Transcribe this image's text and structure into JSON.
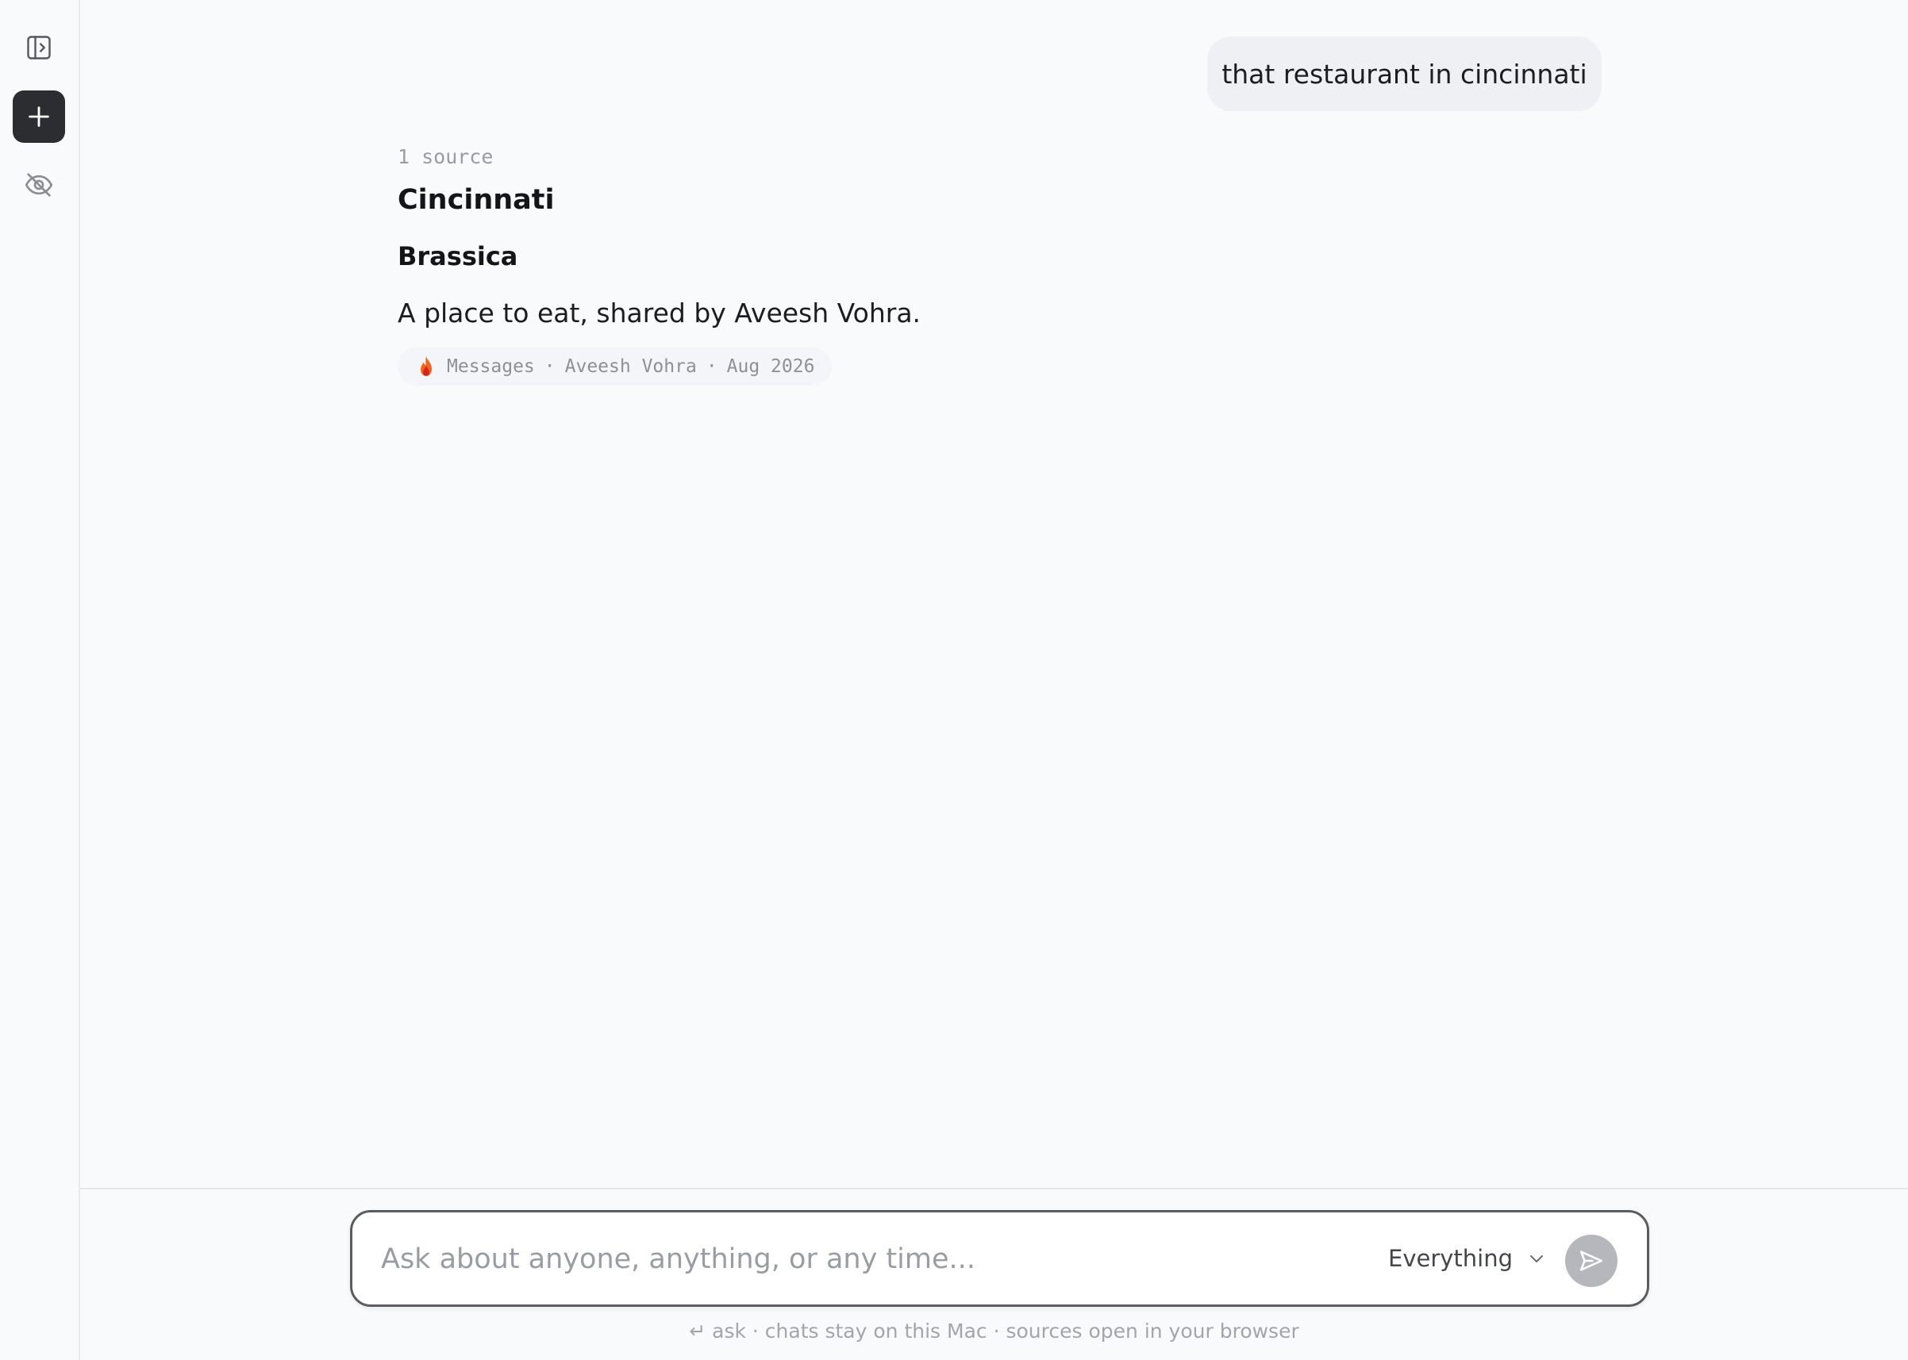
{
  "sidebar": {
    "toggle_icon": "sidebar-toggle-icon",
    "new_chat_icon": "plus-icon",
    "private_icon": "eye-off-icon"
  },
  "conversation": {
    "user_message": "that restaurant in cincinnati",
    "source_count": "1 source",
    "heading": "Cincinnati",
    "subheading": "Brassica",
    "body": "A place to eat, shared by Aveesh Vohra.",
    "citation": {
      "icon": "flame-icon",
      "app": "Messages",
      "person": "Aveesh Vohra",
      "date": "Aug 2026",
      "separator": "·"
    }
  },
  "composer": {
    "placeholder": "Ask about anyone, anything, or any time...",
    "value": "",
    "scope_label": "Everything",
    "send_icon": "send-icon"
  },
  "footer": {
    "hint": "↵ ask · chats stay on this Mac · sources open in your browser"
  },
  "colors": {
    "background": "#f9fafc",
    "new_chat_button": "#2b2d31",
    "send_button_disabled": "#b5b7bc",
    "user_bubble": "#eef0f4",
    "flame_orange": "#f4641c",
    "flame_red": "#d9241c"
  }
}
